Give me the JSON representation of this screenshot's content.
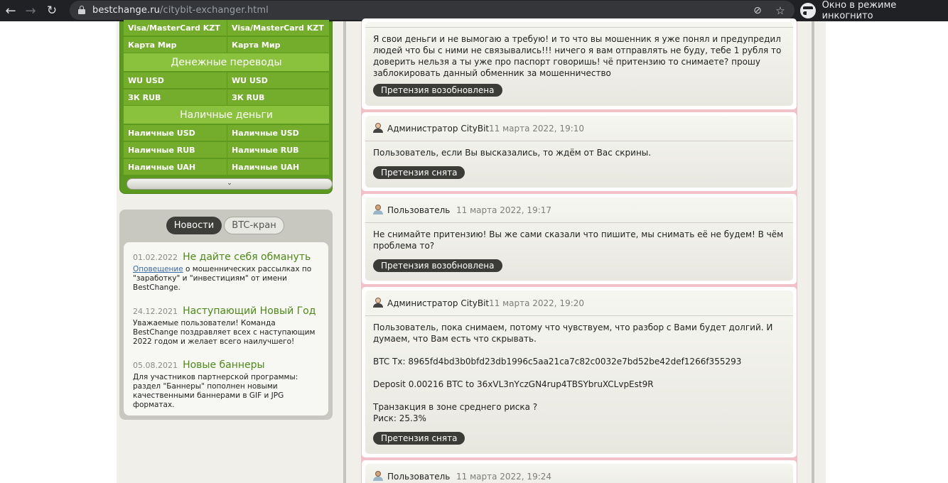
{
  "browser": {
    "url_host": "bestchange.ru",
    "url_path": "/citybit-exchanger.html",
    "incognito_label": "Окно в режиме инкогнито"
  },
  "currencies": {
    "rows_top": [
      [
        "Visa/MasterCard KZT",
        "Visa/MasterCard KZT"
      ],
      [
        "Карта Мир",
        "Карта Мир"
      ]
    ],
    "heading_transfers": "Денежные переводы",
    "rows_transfers": [
      [
        "WU USD",
        "WU USD"
      ],
      [
        "ЗК RUB",
        "ЗК RUB"
      ]
    ],
    "heading_cash": "Наличные деньги",
    "rows_cash": [
      [
        "Наличные USD",
        "Наличные USD"
      ],
      [
        "Наличные RUB",
        "Наличные RUB"
      ],
      [
        "Наличные UAH",
        "Наличные UAH"
      ]
    ]
  },
  "news": {
    "tab_active": "Новости",
    "tab_inactive": "BTC-кран",
    "items": [
      {
        "date": "01.02.2022",
        "title": "Не дайте себя обмануть",
        "link": "Оповещение",
        "text": " о мошеннических рассылках по \"заработку\" и \"инвестициям\" от имени BestChange."
      },
      {
        "date": "24.12.2021",
        "title": "Наступающий Новый Год",
        "text": "Уважаемые пользователи! Команда BestChange поздравляет всех с наступающим 2022 годом и желает всего наилучшего!"
      },
      {
        "date": "05.08.2021",
        "title": "Новые баннеры",
        "text": "Для участников партнерской программы: раздел \"Баннеры\" пополнен новыми качественными баннерами в GIF и JPG форматах."
      }
    ]
  },
  "reviews": [
    {
      "text": "Я свои деньги и не вымогаю а требую! и то что вы мошенник я уже понял и предупредил людей что бы с ними не связывались!!! ничего я вам отправлять не буду, тебе 1 рубля то доверить нельзя а ты уже про паспорт говоришь! чё притензию то снимаете? прошу заблокировать данный обменник за мошенничество",
      "status": "Претензия возобновлена"
    },
    {
      "author": "Администратор CityBit",
      "date": "11 марта 2022, 19:10",
      "text": "Пользователь, если Вы высказались, то ждём от Вас скрины.",
      "status": "Претензия снята"
    },
    {
      "author": "Пользователь",
      "date": "11 марта 2022, 19:17",
      "text": "Не снимайте притензию! Вы же сами сказали что пишите, мы снимать её не будем! В чём проблема то?",
      "status": "Претензия возобновлена"
    },
    {
      "author": "Администратор CityBit",
      "date": "11 марта 2022, 19:20",
      "text_lines": [
        "Пользователь, пока снимаем, потому что чувствуем, что разбор с Вами будет долгий. И думаем, что Вам есть что скрывать.",
        "BTC Tx: 8965fd4bd3b0bfd23db1996c5aa21ca7c82c0032e7bd52be42def1266f355293",
        "Deposit 0.00216 BTC to 36xVL3nYczGN4rup4TBSYbruXCLvpEst9R",
        "Транзакция в зоне среднего риска ?",
        "Риск: 25.3%"
      ],
      "status": "Претензия снята"
    },
    {
      "author": "Пользователь",
      "date": "11 марта 2022, 19:24"
    }
  ]
}
